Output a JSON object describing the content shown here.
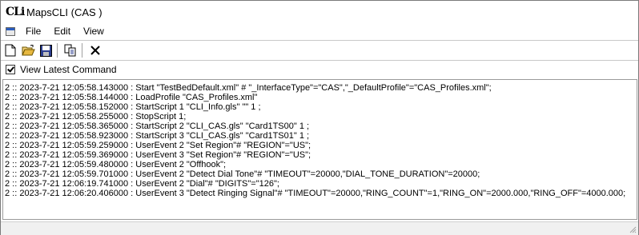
{
  "window": {
    "app_icon_text": "CLi",
    "title": "MapsCLI  (CAS )"
  },
  "menubar": {
    "items": [
      "File",
      "Edit",
      "View"
    ]
  },
  "toolbar": {
    "buttons": [
      "new-file",
      "open-folder",
      "save",
      "copy",
      "cut"
    ]
  },
  "options": {
    "view_latest_command_label": "View Latest Command",
    "view_latest_command_checked": true
  },
  "log": {
    "lines": [
      "2 :: 2023-7-21 12:05:58.143000 : Start \"TestBedDefault.xml\" # \"_InterfaceType\"=\"CAS\",\"_DefaultProfile\"=\"CAS_Profiles.xml\";",
      "2 :: 2023-7-21 12:05:58.144000 : LoadProfile \"CAS_Profiles.xml\"",
      "2 :: 2023-7-21 12:05:58.152000 : StartScript 1 \"CLI_Info.gls\" \"\" 1 ;",
      "2 :: 2023-7-21 12:05:58.255000 : StopScript 1;",
      "2 :: 2023-7-21 12:05:58.365000 : StartScript 2 \"CLI_CAS.gls\" \"Card1TS00\" 1 ;",
      "2 :: 2023-7-21 12:05:58.923000 : StartScript 3 \"CLI_CAS.gls\" \"Card1TS01\" 1 ;",
      "2 :: 2023-7-21 12:05:59.259000 : UserEvent 2 \"Set Region\"# \"REGION\"=\"US\";",
      "2 :: 2023-7-21 12:05:59.369000 : UserEvent 3 \"Set Region\"# \"REGION\"=\"US\";",
      "2 :: 2023-7-21 12:05:59.480000 : UserEvent 2 \"Offhook\";",
      "2 :: 2023-7-21 12:05:59.701000 : UserEvent 2 \"Detect Dial Tone\"# \"TIMEOUT\"=20000,\"DIAL_TONE_DURATION\"=20000;",
      "2 :: 2023-7-21 12:06:19.741000 : UserEvent 2 \"Dial\"# \"DIGITS\"=\"126\";",
      "2 :: 2023-7-21 12:06:20.406000 : UserEvent 3 \"Detect Ringing Signal\"# \"TIMEOUT\"=20000,\"RING_COUNT\"=1,\"RING_ON\"=2000.000,\"RING_OFF\"=4000.000;"
    ]
  }
}
